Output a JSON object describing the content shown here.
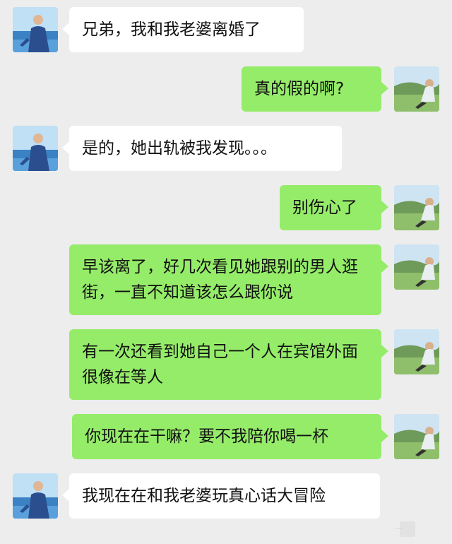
{
  "messages": [
    {
      "side": "left",
      "text": "兄弟，我和我老婆离婚了"
    },
    {
      "side": "right",
      "text": "真的假的啊?"
    },
    {
      "side": "left",
      "text": "是的，她出轨被我发现。。。"
    },
    {
      "side": "right",
      "text": "别伤心了"
    },
    {
      "side": "right",
      "text": "早该离了，好几次看见她跟别的男人逛街，一直不知道该怎么跟你说"
    },
    {
      "side": "right",
      "text": "有一次还看到她自己一个人在宾馆外面很像在等人"
    },
    {
      "side": "right",
      "text": "你现在在干嘛？要不我陪你喝一杯"
    },
    {
      "side": "left",
      "text": "我现在在和我老婆玩真心话大冒险"
    }
  ],
  "watermark": "..."
}
